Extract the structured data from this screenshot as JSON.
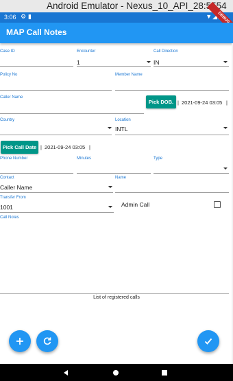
{
  "window": {
    "title": "Android Emulator - Nexus_10_API_28:5554"
  },
  "status_bar": {
    "time": "3:06",
    "debug_banner": "DEBUG"
  },
  "app_bar": {
    "title": "MAP Call Notes"
  },
  "form": {
    "case_id": {
      "label": "Case ID"
    },
    "encounter": {
      "label": "Encounter",
      "value": "1"
    },
    "call_direction": {
      "label": "Call Direction",
      "value": "IN"
    },
    "policy_no": {
      "label": "Policy No"
    },
    "member_name": {
      "label": "Member Name"
    },
    "caller_name": {
      "label": "Caller Name"
    },
    "pick_dob": {
      "label": "Pick DOB.",
      "value": "2021-09-24 03:05"
    },
    "country": {
      "label": "Country"
    },
    "location": {
      "label": "Location",
      "value": "INTL"
    },
    "pick_call_date": {
      "label": "Pick Call Date",
      "value": "2021-09-24 03:05"
    },
    "phone_number": {
      "label": "Phone Number"
    },
    "minutes": {
      "label": "Minutes"
    },
    "type": {
      "label": "Type"
    },
    "contact": {
      "label": "Contact",
      "value": "Caller Name"
    },
    "name": {
      "label": "Name"
    },
    "transfer_from": {
      "label": "Transfer From",
      "value": "1001"
    },
    "admin_call": {
      "label": "Admin Call",
      "checked": false
    },
    "call_notes": {
      "label": "Call Notes"
    }
  },
  "separator": "|",
  "list_caption": "List of registered calls",
  "icons": {
    "add": "add-icon",
    "refresh": "refresh-icon",
    "submit": "check-icon",
    "back": "back-icon",
    "home": "home-icon",
    "recents": "recents-icon"
  },
  "colors": {
    "primary": "#2196f3",
    "status": "#1976d2",
    "teal": "#009688"
  }
}
